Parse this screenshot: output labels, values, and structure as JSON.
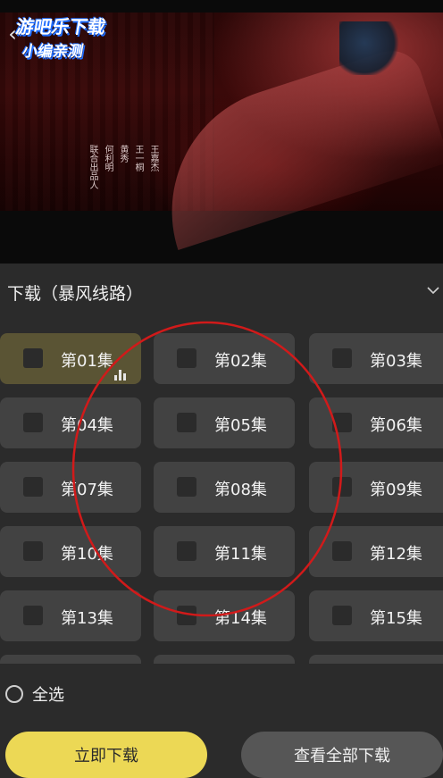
{
  "watermark": {
    "line1": "游吧乐下载",
    "line2": "小编亲测"
  },
  "video": {
    "credits": [
      "王嘉杰",
      "王一桐",
      "黄秀",
      "何利明",
      "联合出品人"
    ]
  },
  "panel": {
    "title": "下载（暴风线路）",
    "episodes": [
      {
        "label": "第01集",
        "active": true
      },
      {
        "label": "第02集"
      },
      {
        "label": "第03集"
      },
      {
        "label": "第04集"
      },
      {
        "label": "第05集"
      },
      {
        "label": "第06集"
      },
      {
        "label": "第07集"
      },
      {
        "label": "第08集"
      },
      {
        "label": "第09集"
      },
      {
        "label": "第10集"
      },
      {
        "label": "第11集"
      },
      {
        "label": "第12集"
      },
      {
        "label": "第13集"
      },
      {
        "label": "第14集"
      },
      {
        "label": "第15集"
      }
    ]
  },
  "footer": {
    "select_all": "全选",
    "download_now": "立即下载",
    "view_all": "查看全部下载"
  },
  "colors": {
    "accent": "#ecd855",
    "annotation": "#d11a1a",
    "panel_bg": "#2b2b2b",
    "tile_bg": "#424242"
  }
}
